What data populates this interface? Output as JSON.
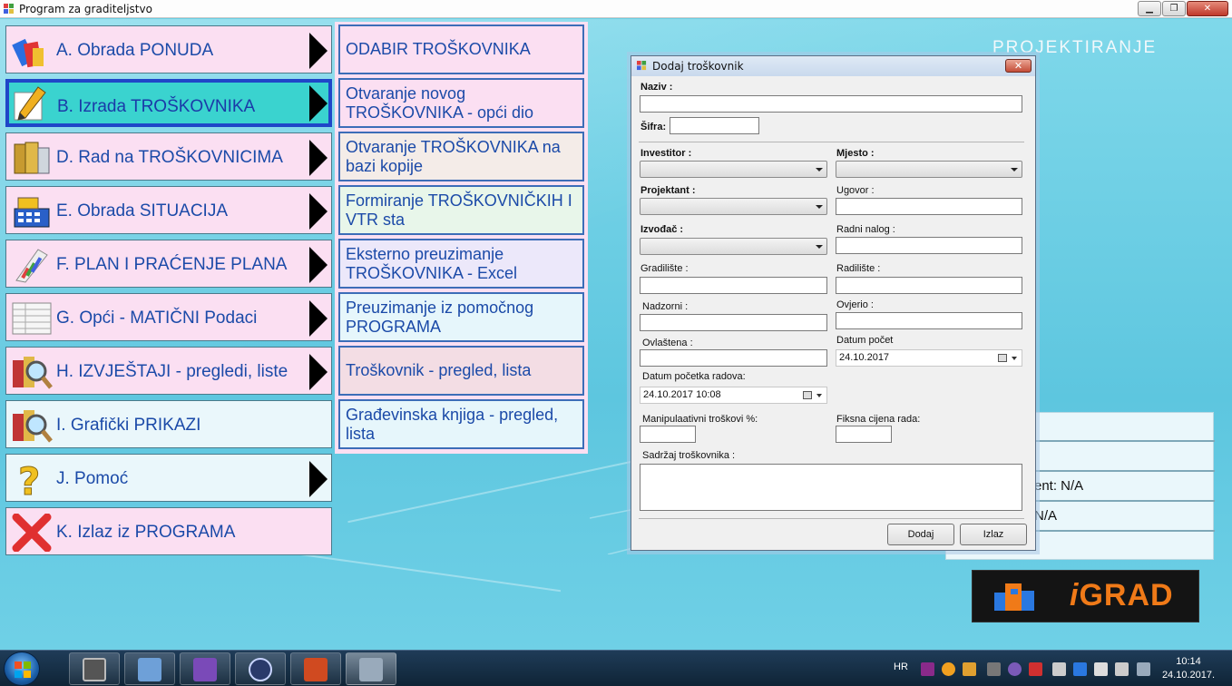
{
  "window": {
    "title": "Program za graditeljstvo",
    "min_label": "▁",
    "max_label": "❐",
    "close_label": "✕"
  },
  "header": {
    "section_title": "PROJEKTIRANJE"
  },
  "menu": {
    "items": [
      {
        "label": "A. Obrada PONUDA",
        "icon": "offer-blocks-icon",
        "has_submenu": true
      },
      {
        "label": "B. Izrada TROŠKOVNIKA",
        "icon": "pencil-icon",
        "has_submenu": true,
        "selected": true
      },
      {
        "label": "D. Rad na TROŠKOVNICIMA",
        "icon": "binders-icon",
        "has_submenu": true
      },
      {
        "label": "E. Obrada SITUACIJA",
        "icon": "cash-register-icon",
        "has_submenu": true
      },
      {
        "label": "F. PLAN I PRAĆENJE PLANA",
        "icon": "chart-icon",
        "has_submenu": true
      },
      {
        "label": "G. Opći - MATIČNI Podaci",
        "icon": "table-icon",
        "has_submenu": true
      },
      {
        "label": "H. IZVJEŠTAJI - pregledi, liste",
        "icon": "magnifier-report-icon",
        "has_submenu": true
      },
      {
        "label": "I. Grafički PRIKAZI",
        "icon": "magnifier-chart-icon",
        "has_submenu": false
      },
      {
        "label": "J. Pomoć",
        "icon": "question-icon",
        "has_submenu": true
      },
      {
        "label": "K. Izlaz iz PROGRAMA",
        "icon": "exit-x-icon",
        "has_submenu": false
      }
    ]
  },
  "submenu": {
    "items": [
      {
        "label": "ODABIR TROŠKOVNIKA"
      },
      {
        "label": "Otvaranje novog TROŠKOVNIKA - opći dio"
      },
      {
        "label": "Otvaranje TROŠKOVNIKA na bazi kopije"
      },
      {
        "label": "Formiranje TROŠKOVNIČKIH I VTR sta"
      },
      {
        "label": "Eksterno preuzimanje TROŠKOVNIKA - Excel"
      },
      {
        "label": "Preuzimanje iz pomočnog PROGRAMA"
      },
      {
        "label": "Troškovnik - pregled, lista"
      },
      {
        "label": "Građevinska knjiga - pregled, lista"
      }
    ]
  },
  "info_panel": {
    "rows": [
      {
        "text": ""
      },
      {
        "text": ""
      },
      {
        "text": "ent: N/A"
      },
      {
        "text": "N/A"
      },
      {
        "text": ""
      }
    ]
  },
  "logo": {
    "text_i": "i",
    "text_grad": "GRAD"
  },
  "dialog": {
    "title": "Dodaj troškovnik",
    "close_label": "✕",
    "fields": {
      "naziv": {
        "label": "Naziv :",
        "value": ""
      },
      "sifra": {
        "label": "Šifra:",
        "value": ""
      },
      "investitor": {
        "label": "Investitor :",
        "value": ""
      },
      "mjesto": {
        "label": "Mjesto :",
        "value": ""
      },
      "projektant": {
        "label": "Projektant :",
        "value": ""
      },
      "ugovor": {
        "label": "Ugovor :",
        "value": ""
      },
      "izvodac": {
        "label": "Izvođač :",
        "value": ""
      },
      "radni_nalog": {
        "label": "Radni nalog :",
        "value": ""
      },
      "gradiliste": {
        "label": "Gradilište :",
        "value": ""
      },
      "radiliste": {
        "label": "Radilište :",
        "value": ""
      },
      "nadzorni": {
        "label": "Nadzorni :",
        "value": ""
      },
      "ovjerio": {
        "label": "Ovjerio :",
        "value": ""
      },
      "ovlastena": {
        "label": "Ovlaštena :",
        "value": ""
      },
      "datum_pocet": {
        "label": "Datum počet",
        "value": "24.10.2017"
      },
      "datum_pocetka_radova": {
        "label": "Datum početka radova:",
        "value": "24.10.2017 10:08"
      },
      "manipulativni": {
        "label": "Manipulaativni troškovi %:",
        "value": ""
      },
      "fiksna_cijena": {
        "label": "Fiksna cijena rada:",
        "value": ""
      },
      "sadrzaj": {
        "label": "Sadržaj troškovnika :",
        "value": ""
      }
    },
    "buttons": {
      "add": "Dodaj",
      "exit": "Izlaz"
    }
  },
  "taskbar": {
    "language": "HR",
    "time": "10:14",
    "date": "24.10.2017.",
    "apps": [
      "media-app-icon",
      "computer-app-icon",
      "visual-studio-icon",
      "browser-app-icon",
      "powerpoint-icon",
      "building-app-icon"
    ]
  },
  "colors": {
    "menu_bg": "#fbdff2",
    "menu_selected": "#3ad3cf",
    "menu_text": "#1b4aa8",
    "client_bg": "#6ccfe4",
    "logo_orange": "#f07a18"
  }
}
